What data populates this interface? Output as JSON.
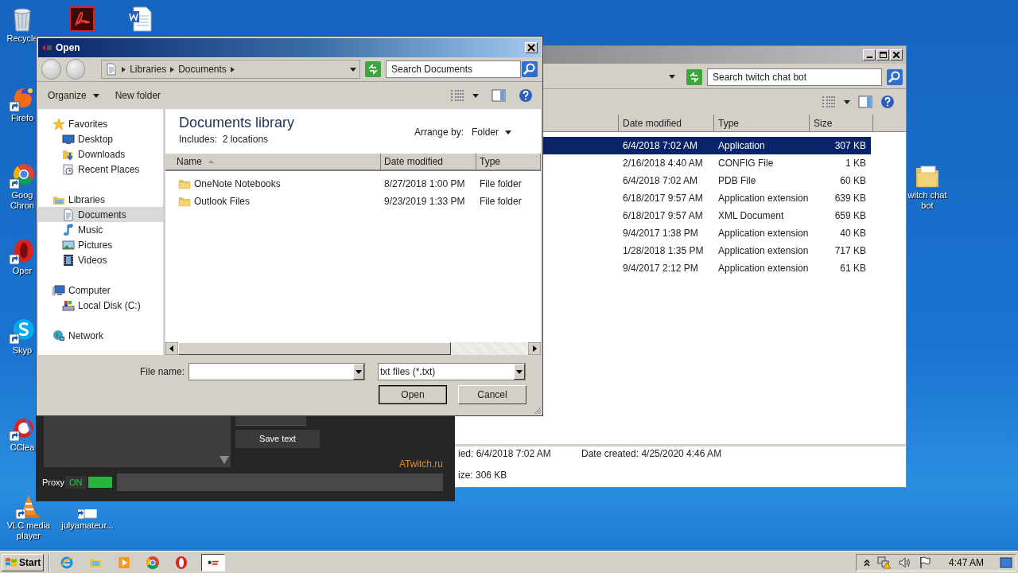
{
  "desktop_icons": [
    {
      "kind": "recycle-bin",
      "label": "Recycle"
    },
    {
      "kind": "pdf"
    },
    {
      "kind": "word"
    },
    {
      "kind": "firefox",
      "label": "Firefo"
    },
    {
      "kind": "chrome",
      "label": "Goog Chron"
    },
    {
      "kind": "opera",
      "label": "Oper"
    },
    {
      "kind": "skype",
      "label": "Skyp"
    },
    {
      "kind": "ccleaner",
      "label": "CClea"
    },
    {
      "kind": "vlc",
      "label": "VLC media player"
    },
    {
      "kind": "document",
      "label": "julyamateur..."
    },
    {
      "kind": "folder",
      "label": "witch chat bot"
    }
  ],
  "explorer_window": {
    "search_placeholder": "Search twitch chat bot",
    "columns": [
      "Date modified",
      "Type",
      "Size"
    ],
    "rows": [
      {
        "date": "6/4/2018 7:02 AM",
        "type": "Application",
        "size": "307 KB",
        "selected": true
      },
      {
        "date": "2/16/2018 4:40 AM",
        "type": "CONFIG File",
        "size": "1 KB",
        "selected": false
      },
      {
        "date": "6/4/2018 7:02 AM",
        "type": "PDB File",
        "size": "60 KB",
        "selected": false
      },
      {
        "date": "6/18/2017 9:57 AM",
        "type": "Application extension",
        "size": "639 KB",
        "selected": false
      },
      {
        "date": "6/18/2017 9:57 AM",
        "type": "XML Document",
        "size": "659 KB",
        "selected": false
      },
      {
        "date": "9/4/2017 1:38 PM",
        "type": "Application extension",
        "size": "40 KB",
        "selected": false
      },
      {
        "date": "1/28/2018 1:35 PM",
        "type": "Application extension",
        "size": "717 KB",
        "selected": false
      },
      {
        "date": "9/4/2017 2:12 PM",
        "type": "Application extension",
        "size": "61 KB",
        "selected": false
      }
    ],
    "details": [
      "ied: 6/4/2018 7:02 AM",
      "Date created: 4/25/2020 4:46 AM",
      "ize: 306 KB"
    ]
  },
  "app_window": {
    "buttons": [
      "Save text"
    ],
    "link": "ATwitch.ru",
    "proxy": {
      "label": "Proxy",
      "state_text": "ON",
      "on": true
    }
  },
  "open_dialog": {
    "title": "Open",
    "breadcrumbs": [
      "Libraries",
      "Documents"
    ],
    "search_placeholder": "Search Documents",
    "toolbar": [
      {
        "label": "Organize",
        "has_menu": true
      },
      {
        "label": "New folder",
        "has_menu": false
      }
    ],
    "nav_groups": [
      {
        "label": "Favorites",
        "kind": "star",
        "selected": false,
        "children": [
          {
            "label": "Desktop",
            "kind": "desktop",
            "selected": false
          },
          {
            "label": "Downloads",
            "kind": "downloads",
            "selected": false
          },
          {
            "label": "Recent Places",
            "kind": "recent",
            "selected": false
          }
        ]
      },
      {
        "label": "Libraries",
        "kind": "library",
        "selected": false,
        "children": [
          {
            "label": "Documents",
            "kind": "documents",
            "selected": true
          },
          {
            "label": "Music",
            "kind": "music",
            "selected": false
          },
          {
            "label": "Pictures",
            "kind": "pictures",
            "selected": false
          },
          {
            "label": "Videos",
            "kind": "videos",
            "selected": false
          }
        ]
      },
      {
        "label": "Computer",
        "kind": "computer",
        "selected": false,
        "children": [
          {
            "label": "Local Disk (C:)",
            "kind": "disk",
            "selected": false
          }
        ]
      },
      {
        "label": "Network",
        "kind": "network",
        "selected": false
      }
    ],
    "library_title": "Documents library",
    "includes": "Includes:  2 locations",
    "arrange_label": "Arrange by:",
    "arrange_value": "Folder",
    "columns": [
      "Name",
      "Date modified",
      "Type"
    ],
    "files": [
      {
        "name": "OneNote Notebooks",
        "date": "8/27/2018 1:00 PM",
        "type": "File folder",
        "selected": false
      },
      {
        "name": "Outlook Files",
        "date": "9/23/2019 1:33 PM",
        "type": "File folder",
        "selected": false
      }
    ],
    "file_name_label": "File name:",
    "file_type": "txt files (*.txt)",
    "buttons": [
      "Open",
      "Cancel"
    ]
  },
  "taskbar": {
    "start": "Start",
    "apps": [
      {
        "kind": "ie",
        "active": false
      },
      {
        "kind": "folder",
        "active": false
      },
      {
        "kind": "media",
        "active": false
      },
      {
        "kind": "chrome",
        "active": false
      },
      {
        "kind": "opera",
        "active": false
      },
      {
        "kind": "chat-bot",
        "active": true
      }
    ],
    "clock": "4:47 AM"
  }
}
